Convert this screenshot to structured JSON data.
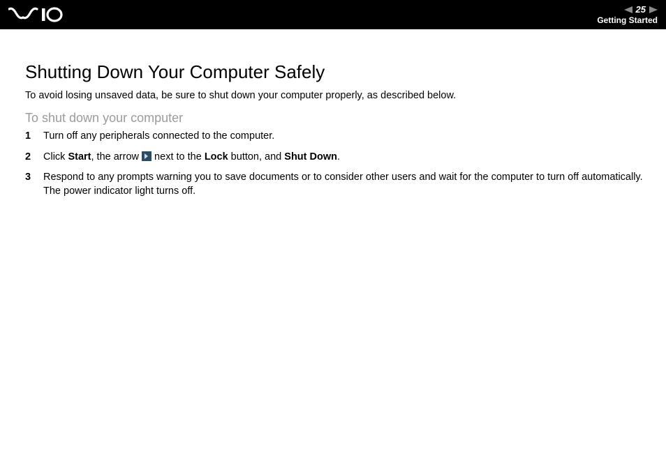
{
  "header": {
    "logo_alt": "VAIO",
    "page_number": "25",
    "section": "Getting Started"
  },
  "page": {
    "title": "Shutting Down Your Computer Safely",
    "intro": "To avoid losing unsaved data, be sure to shut down your computer properly, as described below.",
    "subhead": "To shut down your computer"
  },
  "steps": {
    "s1": "Turn off any peripherals connected to the computer.",
    "s2_a": "Click ",
    "s2_start": "Start",
    "s2_b": ", the arrow ",
    "s2_c": " next to the ",
    "s2_lock": "Lock",
    "s2_d": " button, and ",
    "s2_shutdown": "Shut Down",
    "s2_e": ".",
    "s3_a": "Respond to any prompts warning you to save documents or to consider other users and wait for the computer to turn off automatically.",
    "s3_b": "The power indicator light turns off."
  }
}
